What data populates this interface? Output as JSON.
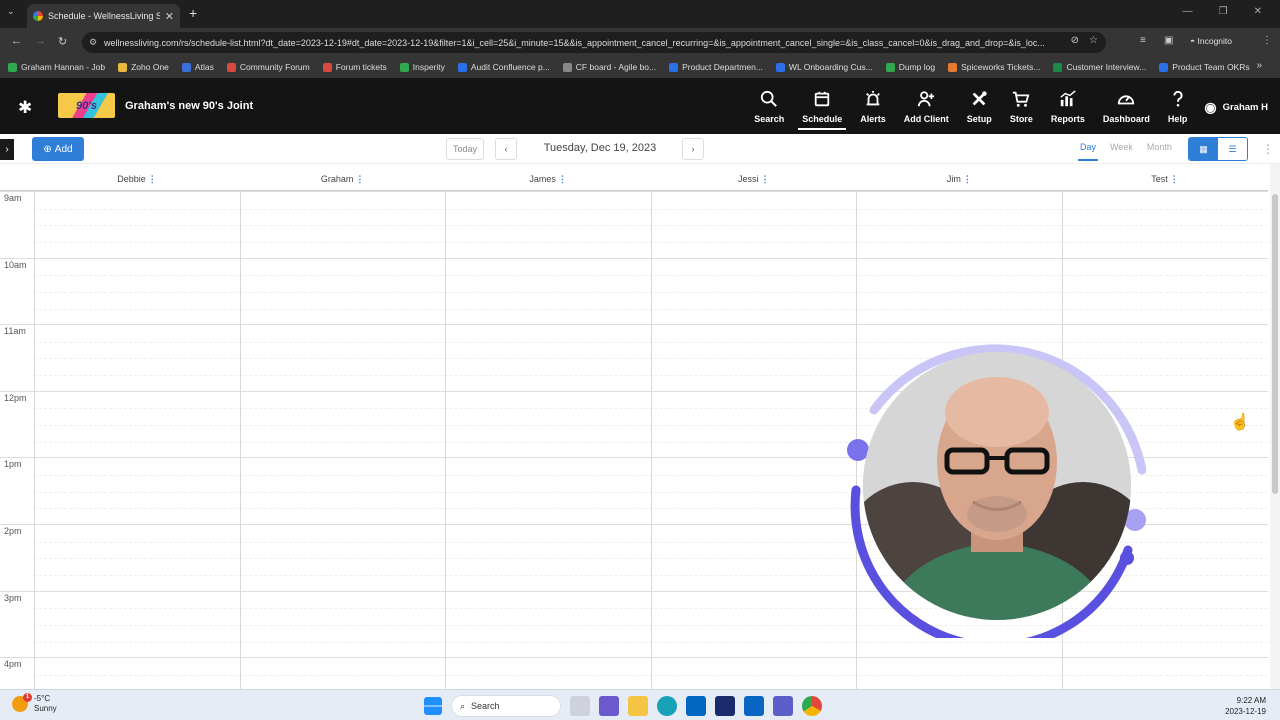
{
  "browser": {
    "tab_title": "Schedule - WellnessLiving Syste",
    "url": "wellnessliving.com/rs/schedule-list.html?dt_date=2023-12-19#dt_date=2023-12-19&filter=1&i_cell=25&i_minute=15&&is_appointment_cancel_recurring=&is_appointment_cancel_single=&is_class_cancel=0&is_drag_and_drop=&is_loc...",
    "incognito_label": "Incognito",
    "bookmarks": [
      {
        "label": "Graham Hannan - Job",
        "color": "#2fa84f"
      },
      {
        "label": "Zoho One",
        "color": "#e8b83a"
      },
      {
        "label": "Atlas",
        "color": "#3b6fd8"
      },
      {
        "label": "Community Forum",
        "color": "#d84a3b"
      },
      {
        "label": "Forum tickets",
        "color": "#d84a3b"
      },
      {
        "label": "Insperity",
        "color": "#2fa84f"
      },
      {
        "label": "Audit Confluence p...",
        "color": "#2b6fe9"
      },
      {
        "label": "CF board - Agile bo...",
        "color": "#888888"
      },
      {
        "label": "Product Departmen...",
        "color": "#2b6fe9"
      },
      {
        "label": "WL Onboarding Cus...",
        "color": "#2b6fe9"
      },
      {
        "label": "Dump log",
        "color": "#2fa84f"
      },
      {
        "label": "Spiceworks Tickets...",
        "color": "#e57b2e"
      },
      {
        "label": "Customer Interview...",
        "color": "#1d8a4a"
      },
      {
        "label": "Product Team OKRs",
        "color": "#2b6fe9"
      }
    ]
  },
  "app": {
    "business_name": "Graham's new 90's Joint",
    "logo_text": "90's",
    "menu": [
      {
        "label": "Search",
        "icon": "search-icon",
        "active": false
      },
      {
        "label": "Schedule",
        "icon": "calendar-icon",
        "active": true
      },
      {
        "label": "Alerts",
        "icon": "alarm-icon",
        "active": false
      },
      {
        "label": "Add Client",
        "icon": "add-user-icon",
        "active": false
      },
      {
        "label": "Setup",
        "icon": "tools-icon",
        "active": false
      },
      {
        "label": "Store",
        "icon": "cart-icon",
        "active": false
      },
      {
        "label": "Reports",
        "icon": "chart-icon",
        "active": false
      },
      {
        "label": "Dashboard",
        "icon": "gauge-icon",
        "active": false
      },
      {
        "label": "Help",
        "icon": "help-icon",
        "active": false
      }
    ],
    "user_name": "Graham H"
  },
  "toolbar": {
    "add_label": "Add",
    "today_label": "Today",
    "date_label": "Tuesday, Dec 19, 2023",
    "views": [
      {
        "label": "Day",
        "active": true
      },
      {
        "label": "Week",
        "active": false
      },
      {
        "label": "Month",
        "active": false
      }
    ]
  },
  "staff": [
    "Debbie",
    "Graham",
    "James",
    "Jessi",
    "Jim",
    "Test"
  ],
  "hours": [
    "9am",
    "10am",
    "11am",
    "12pm",
    "1pm",
    "2pm",
    "3pm",
    "4pm"
  ],
  "taskbar": {
    "temp": "-5°C",
    "weather": "Sunny",
    "weather_badge": "1",
    "search_label": "Search",
    "time": "9:22 AM",
    "date": "2023-12-19"
  },
  "colors": {
    "accent": "#2f7ed8",
    "header_bg": "#141414",
    "webcam_ring": "#6b63e8"
  }
}
